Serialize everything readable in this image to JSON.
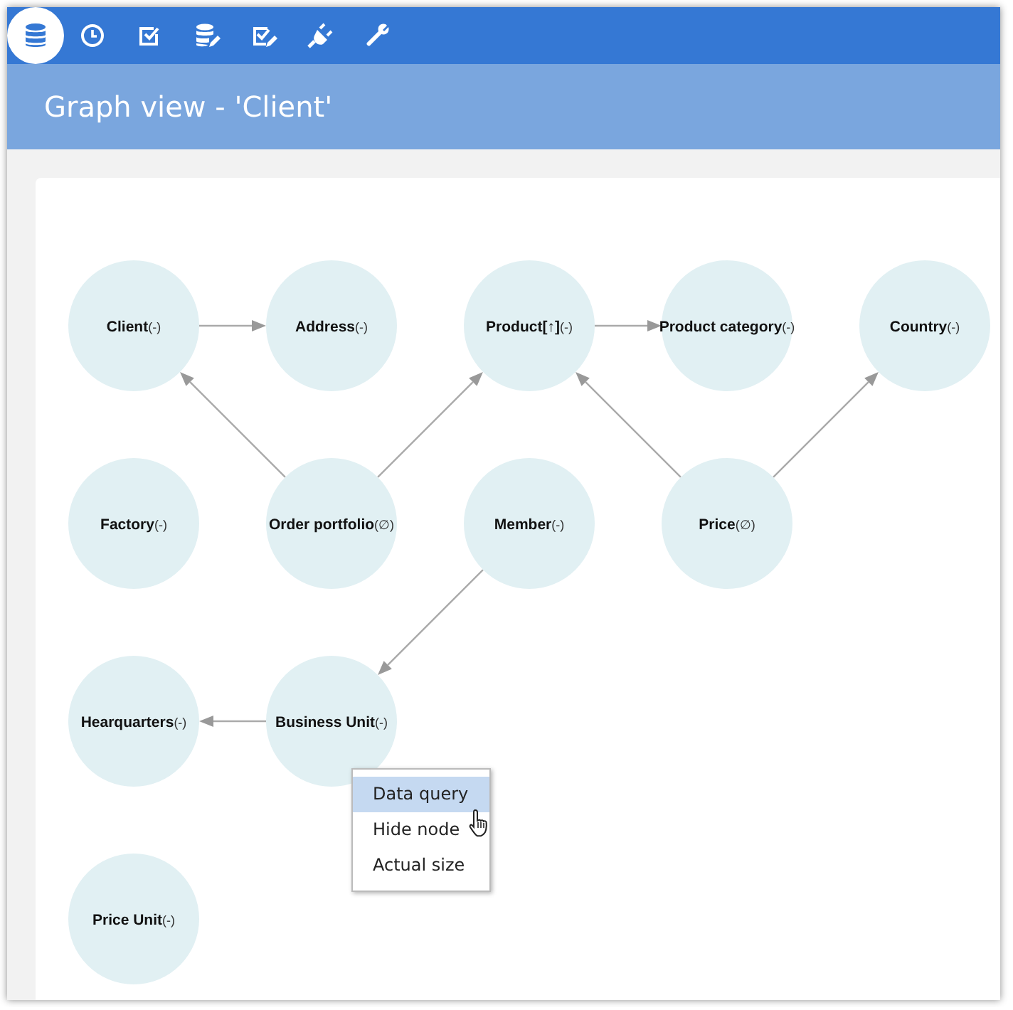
{
  "toolbar": [
    {
      "selected": true
    },
    {
      "selected": false
    },
    {
      "selected": false
    },
    {
      "selected": false
    },
    {
      "selected": false
    },
    {
      "selected": false
    },
    {
      "selected": false
    }
  ],
  "header": {
    "title": "Graph view - 'Client'"
  },
  "graph": {
    "rows": [
      [
        {
          "label": "Client",
          "suffix": "(-)",
          "arrow_right": true
        },
        {
          "label": "Address",
          "suffix": "(-)"
        },
        {
          "label": "Product[↑]",
          "suffix": "(-)",
          "arrow_right": true
        },
        {
          "label": "Product category",
          "suffix": "(-)"
        },
        {
          "label": "Country",
          "suffix": "(-)"
        }
      ],
      [
        {
          "label": "Factory",
          "suffix": "(-)"
        },
        {
          "label": "Order portfolio",
          "suffix": "(∅)",
          "arrow_up_left": true,
          "arrow_up_right": true
        },
        {
          "label": "Member",
          "suffix": "(-)",
          "arrow_down_left": true
        },
        {
          "label": "Price",
          "suffix": "(∅)",
          "arrow_up_left": true,
          "arrow_up_right": true
        }
      ],
      [
        {
          "label": "Hearquarters",
          "suffix": "(-)"
        },
        {
          "label": "Business Unit",
          "suffix": "(-)",
          "arrow_left": true
        }
      ],
      [
        {
          "label": "Price Unit",
          "suffix": "(-)"
        }
      ]
    ]
  },
  "context_menu": {
    "items": [
      {
        "label": "Data query",
        "selected": true
      },
      {
        "label": "Hide node",
        "selected": false
      },
      {
        "label": "Actual size",
        "selected": false
      }
    ]
  }
}
